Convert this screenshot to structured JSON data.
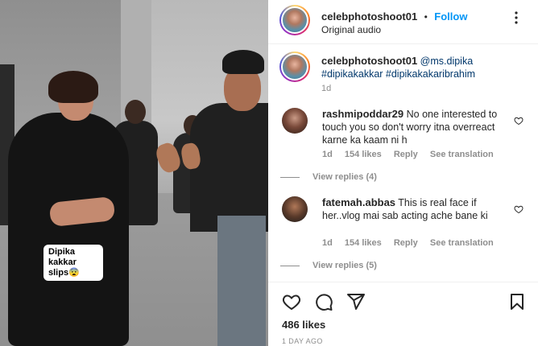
{
  "video": {
    "caption": "Dipika kakkar\nslips😨"
  },
  "header": {
    "username": "celebphotoshoot01",
    "separator": "•",
    "follow_label": "Follow",
    "audio": "Original audio"
  },
  "post_caption": {
    "username": "celebphotoshoot01",
    "mention": "@ms.dipika",
    "hashtags": "#dipikakakkar #dipikakakaribrahim",
    "time": "1d"
  },
  "comments": [
    {
      "username": "rashmipoddar29",
      "text": "No one interested to touch you so don't worry itna overreact karne ka kaam ni h",
      "time": "1d",
      "likes": "154 likes",
      "reply_label": "Reply",
      "translation_label": "See translation",
      "view_replies": "View replies (4)"
    },
    {
      "username": "fatemah.abbas",
      "text": "This is real face if her..vlog mai sab acting ache bane ki",
      "time": "1d",
      "likes": "154 likes",
      "reply_label": "Reply",
      "translation_label": "See translation",
      "view_replies": "View replies (5)"
    }
  ],
  "actions": {
    "icons": [
      "heart-icon",
      "comment-icon",
      "share-icon",
      "bookmark-icon"
    ],
    "likes": "486 likes",
    "posted": "1 DAY AGO"
  },
  "colors": {
    "accent": "#0095f6",
    "hashtag": "#00376b",
    "muted": "#8e8e8e",
    "text": "#262626"
  }
}
